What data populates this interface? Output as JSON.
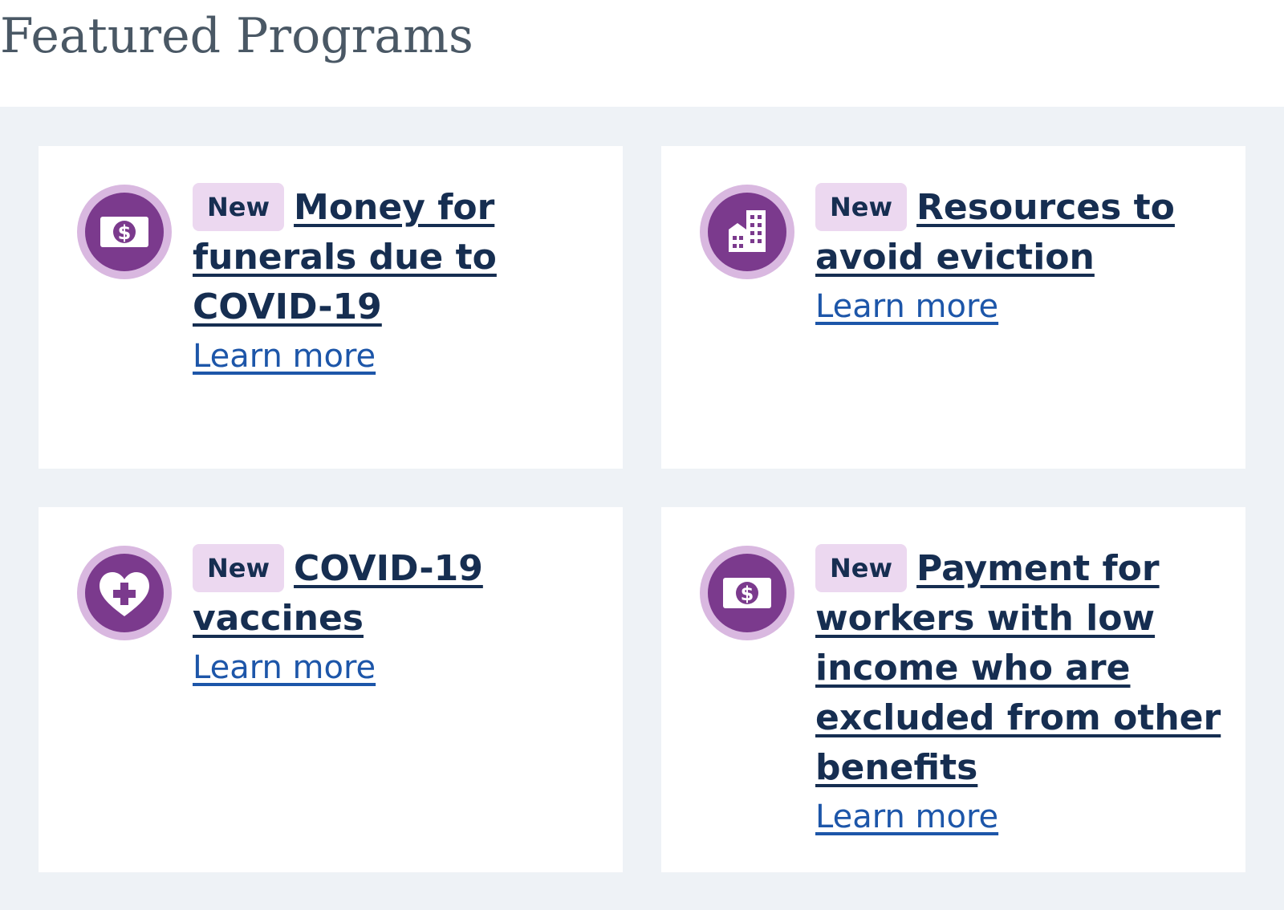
{
  "section": {
    "heading": "Featured Programs"
  },
  "colors": {
    "icon_bg": "#7b3a8d",
    "icon_ring": "#d9b8e0",
    "badge_bg": "#ecd8f0",
    "title": "#162e51",
    "link": "#1d56a9",
    "panel_bg": "#eef2f6"
  },
  "cards": [
    {
      "icon": "money-icon",
      "badge": "New",
      "title": "Money for funerals due to COVID-19",
      "link": "Learn more"
    },
    {
      "icon": "building-icon",
      "badge": "New",
      "title": "Resources to avoid eviction",
      "link": "Learn more"
    },
    {
      "icon": "heart-plus-icon",
      "badge": "New",
      "title": "COVID-19 vaccines",
      "link": "Learn more"
    },
    {
      "icon": "money-icon",
      "badge": "New",
      "title": "Payment for workers with low income who are excluded from other benefits",
      "link": "Learn more"
    }
  ]
}
